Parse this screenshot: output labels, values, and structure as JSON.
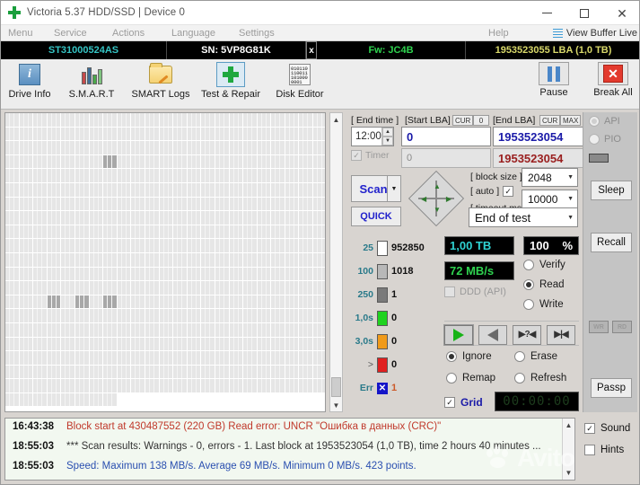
{
  "window": {
    "title": "Victoria 5.37 HDD/SSD | Device 0",
    "app_icon": "green-cross-icon",
    "minimize_label": "–",
    "maximize_label": "",
    "close_label": "✕"
  },
  "menubar": {
    "items": [
      "Menu",
      "Service",
      "Actions",
      "Language",
      "Settings"
    ],
    "help": "Help",
    "view_buffer_live": "View Buffer Live",
    "view_buffer_icon": "list-lines-icon"
  },
  "driveinfo": {
    "model": "ST31000524AS",
    "serial": "SN: 5VP8G81K",
    "close_serial": "x",
    "firmware": "Fw: JC4B",
    "capacity": "1953523055 LBA (1,0 TB)",
    "color_model": "#35c4c4",
    "color_fw": "#2fd34f",
    "color_lba": "#d9d96a"
  },
  "toolbar": {
    "drive_info": "Drive Info",
    "smart": "S.M.A.R.T",
    "smart_logs": "SMART Logs",
    "test_repair": "Test & Repair",
    "disk_editor": "Disk Editor",
    "pause": "Pause",
    "break_all": "Break All",
    "binary_glyph": "010110\n110011\n101000\n0001"
  },
  "params": {
    "end_time_label": "[ End time ]",
    "end_time_value": "12:00",
    "timer_label": "Timer",
    "timer_value": "0",
    "start_lba_label": "[Start LBA]",
    "start_lba_cur": "CUR",
    "start_lba_zero": "0",
    "start_lba_value": "0",
    "end_lba_label": "[End LBA]",
    "end_lba_cur": "CUR",
    "end_lba_max": "MAX",
    "end_lba_value": "1953523054",
    "end_lba_value2": "1953523054",
    "scan_button": "Scan",
    "quick_button": "QUICK",
    "dpad_icon": "dpad-navigation-icon",
    "block_size_label": "[ block size ]",
    "auto_label": "[ auto ]",
    "auto_checked": true,
    "timeout_label": "[ timeout,ms ]",
    "block_size_value": "2048",
    "timeout_value": "10000",
    "end_of_test_value": "End of test"
  },
  "timing_stats": {
    "rows": [
      {
        "label": "25",
        "color": "#ffffff",
        "count": "952850"
      },
      {
        "label": "100",
        "color": "#b8b8b8",
        "count": "1018"
      },
      {
        "label": "250",
        "color": "#7a7a7a",
        "count": "1"
      },
      {
        "label": "1,0s",
        "color": "#1fd21f",
        "count": "0"
      },
      {
        "label": "3,0s",
        "color": "#f09a1a",
        "count": "0"
      },
      {
        "label": ">",
        "color": "#e02020",
        "count": "0"
      },
      {
        "label": "Err",
        "color": "#1515c8",
        "count": "1"
      }
    ]
  },
  "status": {
    "capacity": "1,00 TB",
    "percent_value": "100",
    "percent_unit": "%",
    "speed": "72 MB/s",
    "ddd_label": "DDD (API)",
    "ddd_checked": false,
    "modes": [
      {
        "label": "Verify",
        "selected": false
      },
      {
        "label": "Read",
        "selected": true
      },
      {
        "label": "Write",
        "selected": false
      }
    ],
    "media_buttons": [
      "play-forward-icon",
      "play-reverse-icon",
      "skip-query-icon",
      "skip-end-icon"
    ],
    "actions": [
      {
        "label": "Ignore",
        "selected": true
      },
      {
        "label": "Erase",
        "selected": false
      },
      {
        "label": "Remap",
        "selected": false
      },
      {
        "label": "Refresh",
        "selected": false
      }
    ],
    "grid_label": "Grid",
    "grid_checked": true,
    "clock": "00:00:00"
  },
  "sidebar": {
    "api_label": "API",
    "pio_label": "PIO",
    "sleep_label": "Sleep",
    "recall_label": "Recall",
    "wr_label": "WR",
    "rd_label": "RD",
    "passp_label": "Passp"
  },
  "log": {
    "lines": [
      {
        "time": "16:43:38",
        "text": "Block start at 430487552 (220 GB) Read error: UNCR \"Ошибка в данных (CRC)\"",
        "kind": "red"
      },
      {
        "time": "18:55:03",
        "text": "*** Scan results: Warnings - 0, errors - 1. Last block at 1953523054 (1,0 TB), time 2 hours 40 minutes ...",
        "kind": "gray"
      },
      {
        "time": "18:55:03",
        "text": "Speed: Maximum 138 MB/s. Average 69 MB/s. Minimum 0 MB/s. 423 points.",
        "kind": "blue"
      }
    ],
    "sound_label": "Sound",
    "sound_checked": true,
    "hints_label": "Hints",
    "hints_checked": false
  },
  "watermark": {
    "text": "Avito",
    "icon": "paw-icon"
  },
  "map": {
    "cols": 23,
    "rows": 21,
    "dark_cells": [
      [
        3,
        7
      ],
      [
        13,
        3
      ],
      [
        13,
        5
      ],
      [
        13,
        7
      ]
    ],
    "last_row_filled": 8
  }
}
